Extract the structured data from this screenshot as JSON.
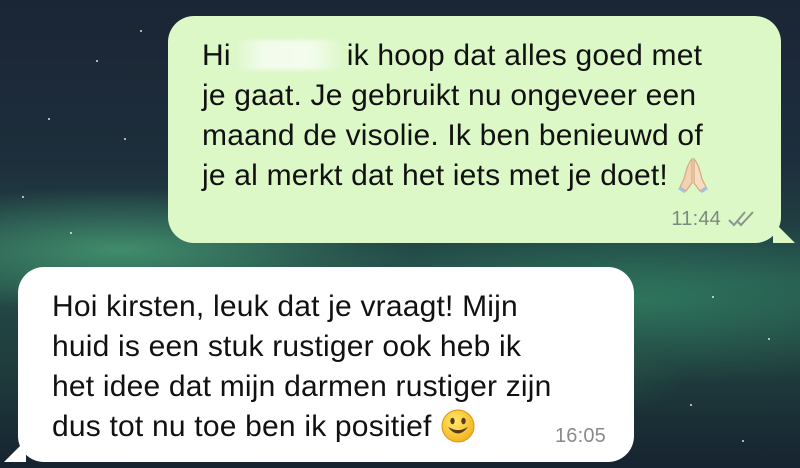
{
  "messages": [
    {
      "direction": "outgoing",
      "lines": [
        "Hi",
        "ik hoop dat alles goed met",
        "je gaat. Je gebruikt nu ongeveer een",
        "maand de visolie. Ik ben benieuwd of",
        "je al merkt dat het iets met je doet!"
      ],
      "emoji": "folded-hands-icon",
      "time": "11:44",
      "status": "read",
      "bubble_color": "#dcf8c6"
    },
    {
      "direction": "incoming",
      "lines": [
        "Hoi kirsten, leuk dat je vraagt! Mijn",
        "huid is een stuk rustiger ook heb ik",
        "het idee dat mijn darmen rustiger zijn",
        "dus tot nu toe ben ik positief"
      ],
      "emoji": "smiley-icon",
      "time": "16:05",
      "bubble_color": "#ffffff"
    }
  ]
}
